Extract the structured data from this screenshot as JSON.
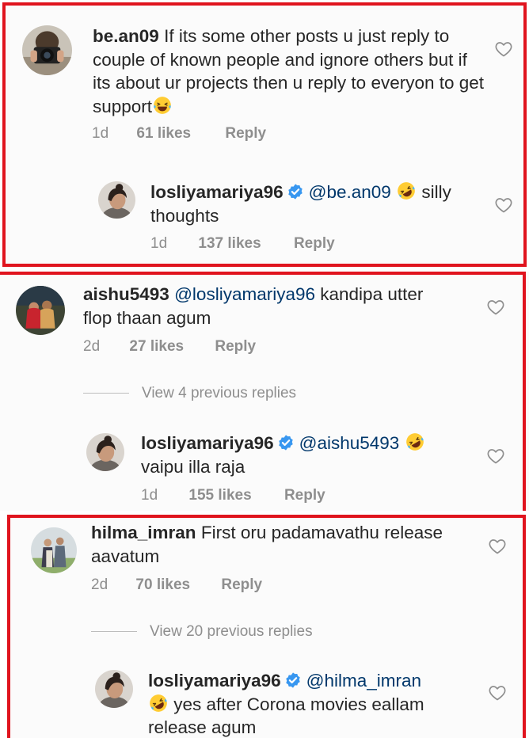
{
  "threads": [
    {
      "comment": {
        "username": "be.an09",
        "text": "If its some other posts u just reply to couple of known people and ignore others but if its about ur projects then u reply to everyon to get support",
        "emoji": "laughing",
        "time": "1d",
        "likes": "61 likes",
        "reply": "Reply"
      },
      "reply": {
        "username": "losliyamariya96",
        "mention": "@be.an09",
        "text_after_emoji": "silly",
        "text_line2": "thoughts",
        "time": "1d",
        "likes": "137 likes",
        "reply": "Reply"
      }
    },
    {
      "comment": {
        "username": "aishu5493",
        "mention": "@losliyamariya96",
        "text": "kandipa utter",
        "text_line2": "flop thaan agum",
        "time": "2d",
        "likes": "27 likes",
        "reply": "Reply"
      },
      "view_replies": "View 4 previous replies",
      "reply": {
        "username": "losliyamariya96",
        "mention": "@aishu5493",
        "text_line2": "vaipu illa raja",
        "time": "1d",
        "likes": "155 likes",
        "reply": "Reply"
      }
    },
    {
      "comment": {
        "username": "hilma_imran",
        "text": "First oru padamavathu release",
        "text_line2": "aavatum",
        "time": "2d",
        "likes": "70 likes",
        "reply": "Reply"
      },
      "view_replies": "View 20 previous replies",
      "reply": {
        "username": "losliyamariya96",
        "mention": "@hilma_imran",
        "text_line2": "yes after Corona movies eallam",
        "text_line3": "release agum"
      }
    }
  ],
  "colors": {
    "highlight_border": "#e0141e",
    "mention": "#00376b",
    "verified": "#3897f0",
    "meta": "#8e8e8e"
  }
}
